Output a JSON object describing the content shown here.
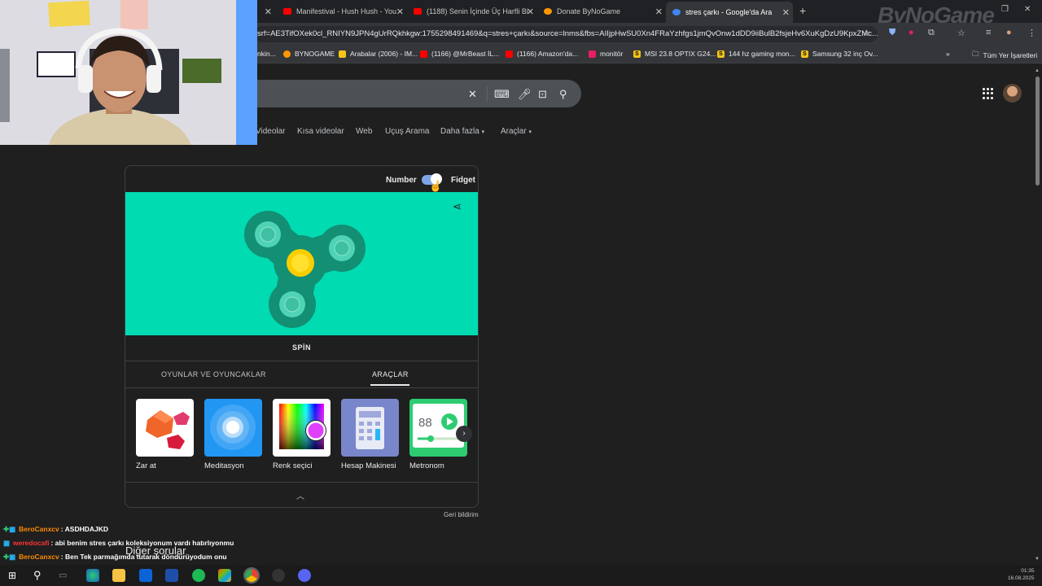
{
  "tabs": [
    {
      "title": "Manifestival - Hush Hush - You",
      "color": "#ff0000"
    },
    {
      "title": "(1188) Senin İçinde Üç Harfli Bi",
      "color": "#ff0000"
    },
    {
      "title": "Donate ByNoGame",
      "color": "#ff9800"
    },
    {
      "title": "stres çarkı - Google'da Ara",
      "color": "#4285f4"
    }
  ],
  "address": {
    "url": "srf=AE3TifOXek0cl_RNIYN9JPN4gUrRQkhkgw:1755298491469&q=stres+çarkı&source=lnms&fbs=AIIjpHwSU0Xn4FRaYzhfgs1jmQvOnw1dDD9iiBulB2fsjeHv6XuKgDzU9KpxZMc..."
  },
  "bookmarks": [
    {
      "label": "nkin...",
      "color": "#4285f4",
      "glyph": ""
    },
    {
      "label": "BYNOGAME",
      "color": "#ff9800",
      "glyph": ""
    },
    {
      "label": "Arabalar (2006) - IM...",
      "color": "#f5c518",
      "glyph": ""
    },
    {
      "label": "(1166) @MrBeast İL...",
      "color": "#ff0000",
      "glyph": ""
    },
    {
      "label": "(1166) Amazon'da...",
      "color": "#ff0000",
      "glyph": ""
    },
    {
      "label": "monitör",
      "color": "#e91e63",
      "glyph": ""
    },
    {
      "label": "MSI 23.8 OPTIX G24...",
      "color": "#f5c518",
      "glyph": "S"
    },
    {
      "label": "144 hz gaming mon...",
      "color": "#f5c518",
      "glyph": "S"
    },
    {
      "label": "Samsung 32 inç Ov...",
      "color": "#f5c518",
      "glyph": "S"
    },
    {
      "label": "Tüm Yer İşaretleri",
      "color": "#c4c7c5",
      "glyph": ""
    }
  ],
  "filters": [
    "Videolar",
    "Kısa videolar",
    "Web",
    "Uçuş Arama",
    "Daha fazla",
    "Araçlar"
  ],
  "spinner": {
    "mode_left": "Number",
    "mode_right": "Fidget",
    "spin_label": "SPİN",
    "colors": {
      "stage": "#00dbb2",
      "body": "#138f74",
      "center": "#f9ce00"
    }
  },
  "categories": {
    "games": "OYUNLAR VE OYUNCAKLAR",
    "tools": "ARAÇLAR"
  },
  "tools": [
    {
      "label": "Zar at",
      "icon": "dice-icon"
    },
    {
      "label": "Meditasyon",
      "icon": "meditation-icon"
    },
    {
      "label": "Renk seçici",
      "icon": "color-picker-icon"
    },
    {
      "label": "Hesap Makinesi",
      "icon": "calculator-icon"
    },
    {
      "label": "Metronom",
      "icon": "metronome-icon"
    }
  ],
  "metronome_value": "88",
  "feedback": "Geri bildirim",
  "more_questions": "Diğer sorular",
  "chat": [
    {
      "user": "BeroCanxcv",
      "msg": ": ASDHDAJKD",
      "color": "#ff8a00"
    },
    {
      "user": "weredocafi",
      "msg": ": abi benim stres çarkı koleksiyonum vardı hatırlıyonmu",
      "color": "#ff3333"
    },
    {
      "user": "BeroCanxcv",
      "msg": ": Ben Tek parmağımda tutarak döndürüyodum onu",
      "color": "#ff8a00"
    }
  ],
  "clock": {
    "time": "01:35",
    "date": "16.08.2025"
  },
  "brand": "ByNoGame"
}
